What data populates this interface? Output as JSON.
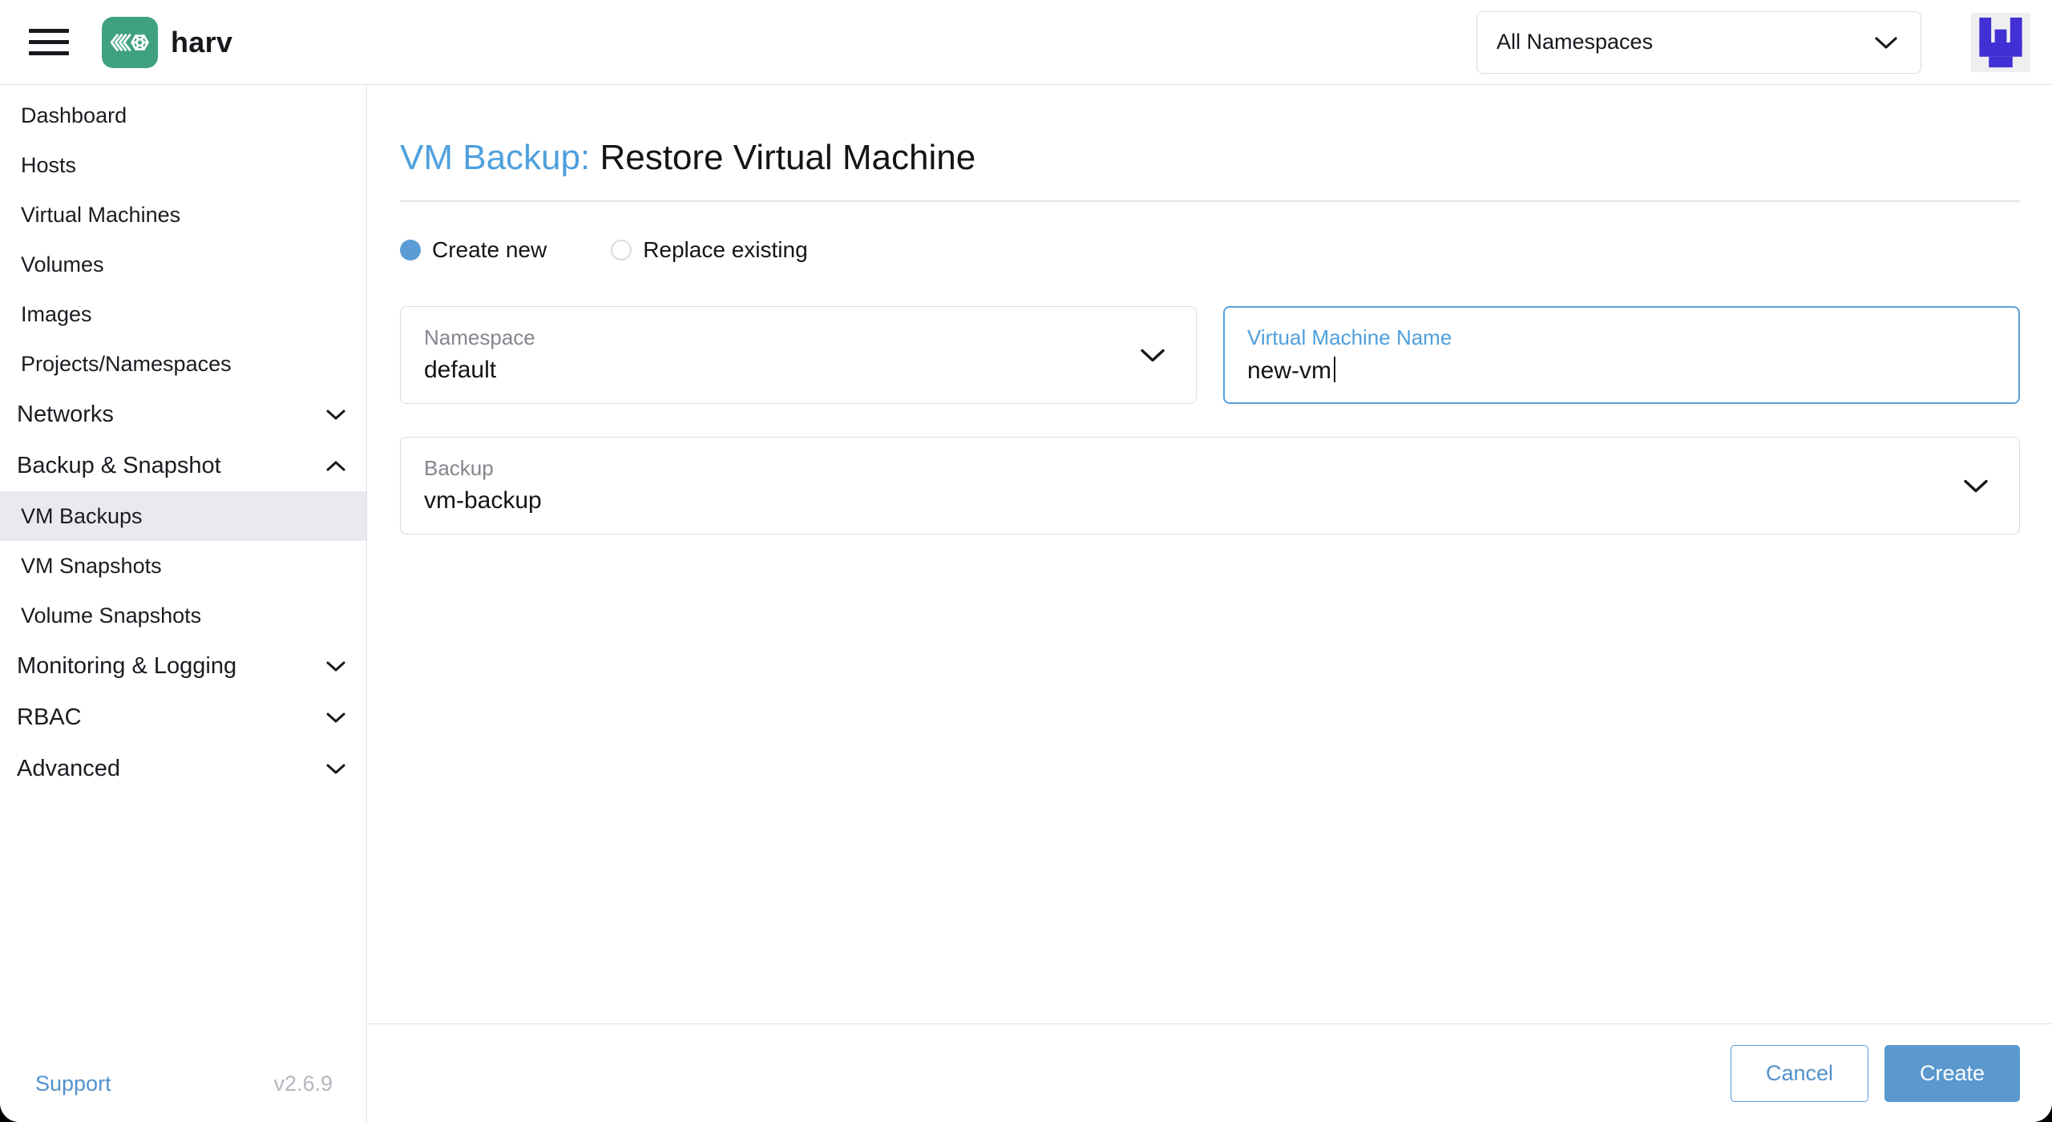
{
  "header": {
    "brand": "harv",
    "namespace_filter": {
      "value": "All Namespaces"
    }
  },
  "sidebar": {
    "items": [
      {
        "label": "Dashboard"
      },
      {
        "label": "Hosts"
      },
      {
        "label": "Virtual Machines"
      },
      {
        "label": "Volumes"
      },
      {
        "label": "Images"
      },
      {
        "label": "Projects/Namespaces"
      },
      {
        "label": "Networks",
        "state": "collapsed"
      },
      {
        "label": "Backup & Snapshot",
        "state": "expanded"
      },
      {
        "label": "VM Backups",
        "selected": true
      },
      {
        "label": "VM Snapshots"
      },
      {
        "label": "Volume Snapshots"
      },
      {
        "label": "Monitoring & Logging",
        "state": "collapsed"
      },
      {
        "label": "RBAC",
        "state": "collapsed"
      },
      {
        "label": "Advanced",
        "state": "collapsed"
      }
    ],
    "footer": {
      "support": "Support",
      "version": "v2.6.9"
    }
  },
  "main": {
    "title_prefix": "VM Backup:",
    "title": "Restore Virtual Machine",
    "radios": [
      {
        "label": "Create new",
        "selected": true
      },
      {
        "label": "Replace existing",
        "selected": false
      }
    ],
    "fields": {
      "namespace": {
        "label": "Namespace",
        "value": "default"
      },
      "vm_name": {
        "label": "Virtual Machine Name",
        "value": "new-vm"
      },
      "backup": {
        "label": "Backup",
        "value": "vm-backup"
      }
    },
    "actions": {
      "cancel": "Cancel",
      "create": "Create"
    }
  },
  "colors": {
    "primary_blue": "#5a98ce",
    "link_blue": "#4fa0dd",
    "logo_green": "#3fa182",
    "identicon_indigo": "#4130d3",
    "selected_row_bg": "#e9eaf0",
    "divider_gray": "#dee1e8",
    "label_gray": "#84868e"
  }
}
